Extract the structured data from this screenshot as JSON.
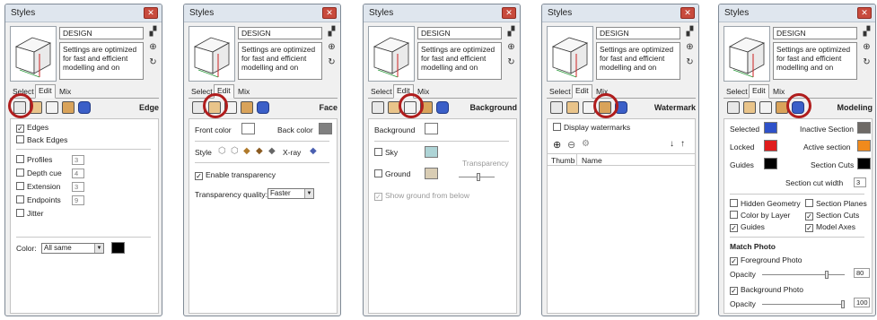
{
  "window_title": "Styles",
  "style_name": "DESIGN",
  "style_description": "Settings are optimized for fast and efficient modelling and on",
  "tabs": {
    "select": "Select",
    "edit": "Edit",
    "mix": "Mix"
  },
  "colors": {
    "circle": "#b01d1d",
    "selected": "#2f52c9",
    "locked": "#e01c1c",
    "guides": "#000000",
    "inactive": "#6e6a66",
    "active": "#f08a1c",
    "cuts": "#000000",
    "background": "#ffffff",
    "sky": "#aed4d6",
    "ground": "#d9cdb4",
    "front": "#ffffff",
    "back": "#808080",
    "edge_color": "#000000"
  },
  "edge_panel": {
    "title": "Edge",
    "edges": "Edges",
    "back_edges": "Back Edges",
    "profiles": "Profiles",
    "profiles_val": "3",
    "depth_cue": "Depth cue",
    "depth_val": "4",
    "extension": "Extension",
    "extension_val": "3",
    "endpoints": "Endpoints",
    "endpoints_val": "9",
    "jitter": "Jitter",
    "color_label": "Color:",
    "color_value": "All same"
  },
  "face_panel": {
    "title": "Face",
    "front_color": "Front color",
    "back_color": "Back color",
    "style_label": "Style",
    "xray": "X-ray",
    "enable_transparency": "Enable transparency",
    "transparency_quality": "Transparency quality:",
    "quality_value": "Faster"
  },
  "background_panel": {
    "title": "Background",
    "background": "Background",
    "sky": "Sky",
    "ground": "Ground",
    "transparency": "Transparency",
    "show_ground": "Show ground from below"
  },
  "watermark_panel": {
    "title": "Watermark",
    "display_watermarks": "Display watermarks",
    "col_thumb": "Thumb",
    "col_name": "Name"
  },
  "modeling_panel": {
    "title": "Modeling",
    "selected": "Selected",
    "inactive_section": "Inactive Section",
    "locked": "Locked",
    "active_section": "Active section",
    "guides": "Guides",
    "section_cuts": "Section Cuts",
    "section_cut_width": "Section cut width",
    "section_cut_width_val": "3",
    "hidden_geometry": "Hidden Geometry",
    "section_planes": "Section Planes",
    "color_by_layer": "Color by Layer",
    "section_cuts_cb": "Section Cuts",
    "guides_cb": "Guides",
    "model_axes": "Model Axes",
    "match_photo": "Match Photo",
    "foreground_photo": "Foreground Photo",
    "opacity": "Opacity",
    "fg_opacity_val": "80",
    "background_photo": "Background Photo",
    "bg_opacity_val": "100"
  }
}
